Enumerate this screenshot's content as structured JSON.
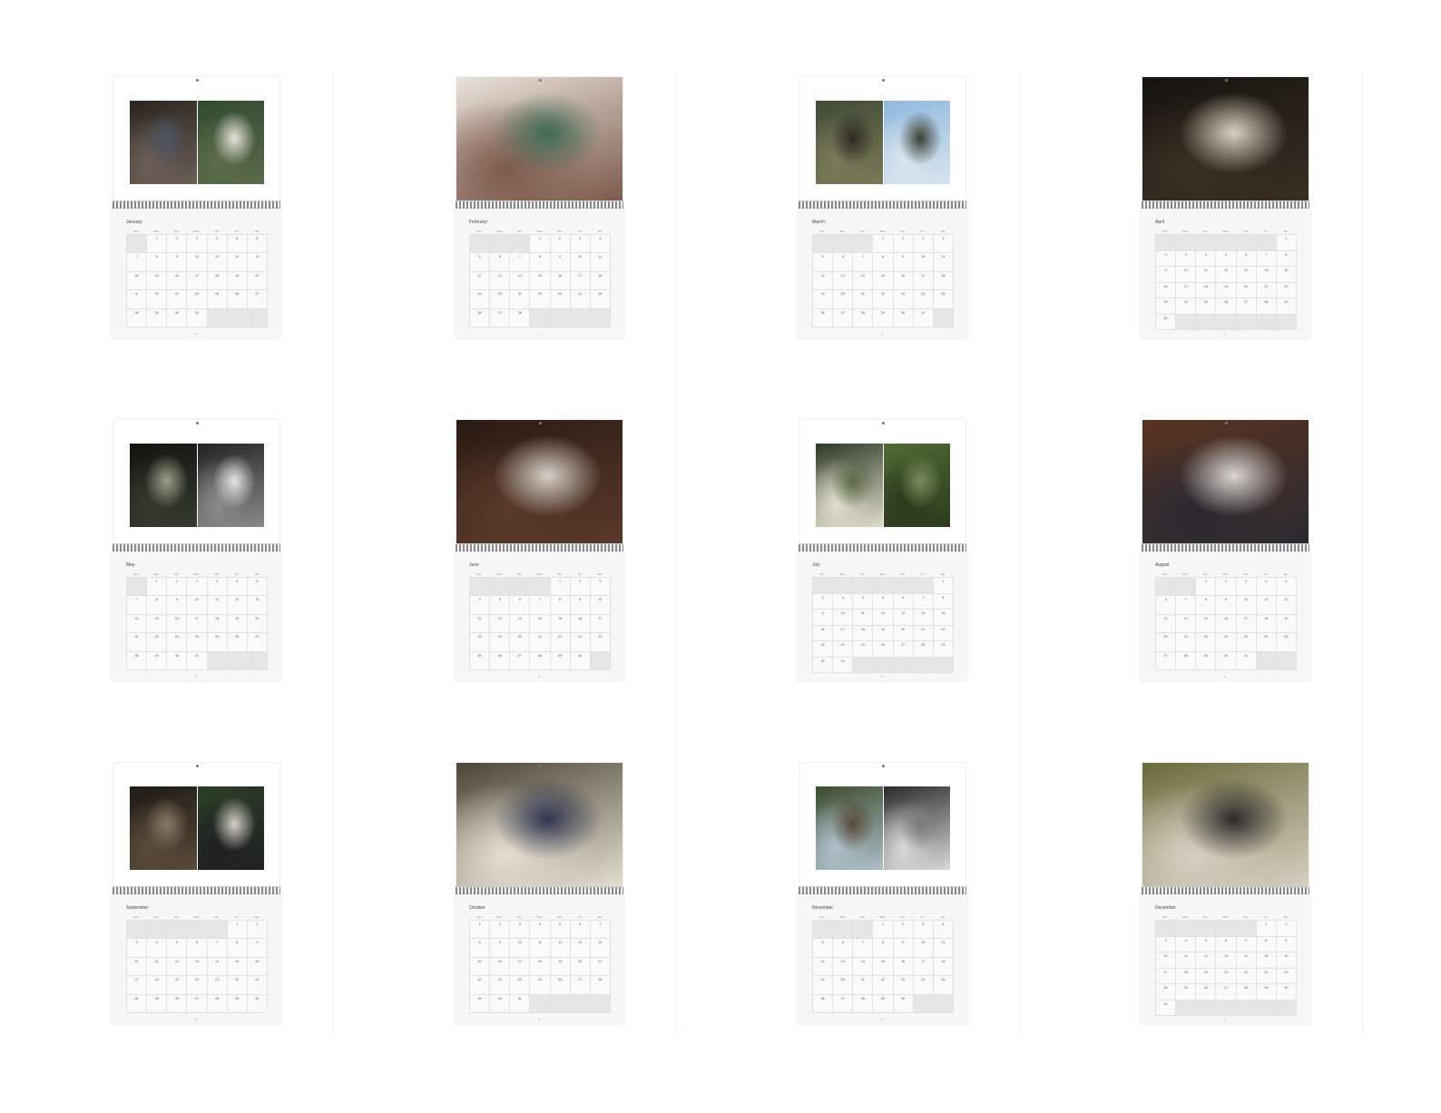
{
  "weekday_headers": [
    "Sun",
    "Mon",
    "Tue",
    "Wed",
    "Thu",
    "Fri",
    "Sat"
  ],
  "calendars": [
    {
      "month": "January",
      "blank_before": 1,
      "days_in_month": 31,
      "photo_layout": "split",
      "photos": [
        {
          "name": "man-reclining-on-sofa-photo",
          "colors": [
            "#2b241f",
            "#6b5f57",
            "#4d5566"
          ]
        },
        {
          "name": "three-men-portrait-photo",
          "colors": [
            "#304a2e",
            "#5b6b4b",
            "#e6e2da"
          ]
        }
      ]
    },
    {
      "month": "February",
      "blank_before": 3,
      "days_in_month": 28,
      "photo_layout": "full",
      "photos": [
        {
          "name": "three-men-at-window-photo",
          "colors": [
            "#e9e2da",
            "#7d5a4c",
            "#3f6b55"
          ]
        }
      ]
    },
    {
      "month": "March",
      "blank_before": 3,
      "days_in_month": 31,
      "photo_layout": "split",
      "photos": [
        {
          "name": "man-in-foliage-photo",
          "colors": [
            "#3f4a33",
            "#7b7a5a",
            "#2e2a24"
          ]
        },
        {
          "name": "three-men-against-sky-photo",
          "colors": [
            "#8fb8de",
            "#d8e4ee",
            "#3b3f33"
          ]
        }
      ]
    },
    {
      "month": "April",
      "blank_before": 6,
      "days_in_month": 30,
      "photo_layout": "full",
      "photos": [
        {
          "name": "man-seated-in-dark-room-photo",
          "colors": [
            "#15130f",
            "#3a2f24",
            "#d8d1bf"
          ]
        }
      ]
    },
    {
      "month": "May",
      "blank_before": 1,
      "days_in_month": 31,
      "photo_layout": "split",
      "photos": [
        {
          "name": "man-in-leather-jacket-photo",
          "colors": [
            "#12140f",
            "#343a2e",
            "#9aa08c"
          ]
        },
        {
          "name": "black-and-white-portrait-photo",
          "colors": [
            "#222222",
            "#8a8a8a",
            "#e5e5e5"
          ]
        }
      ]
    },
    {
      "month": "June",
      "blank_before": 4,
      "days_in_month": 30,
      "photo_layout": "full",
      "photos": [
        {
          "name": "man-sitting-on-bed-photo",
          "colors": [
            "#2a1a14",
            "#5a3a2a",
            "#d6d0c8"
          ]
        }
      ]
    },
    {
      "month": "July",
      "blank_before": 6,
      "days_in_month": 31,
      "photo_layout": "split",
      "photos": [
        {
          "name": "man-in-white-sweater-photo",
          "colors": [
            "#2e3a26",
            "#e0dccd",
            "#5b6a45"
          ]
        },
        {
          "name": "man-lying-in-grass-photo",
          "colors": [
            "#4f6a32",
            "#2b3a1d",
            "#7a8a5a"
          ]
        }
      ]
    },
    {
      "month": "August",
      "blank_before": 2,
      "days_in_month": 31,
      "photo_layout": "full",
      "photos": [
        {
          "name": "man-in-striped-shirt-photo",
          "colors": [
            "#5a3322",
            "#2a2a30",
            "#d9d6d2"
          ]
        }
      ]
    },
    {
      "month": "September",
      "blank_before": 5,
      "days_in_month": 30,
      "photo_layout": "split",
      "photos": [
        {
          "name": "man-reclining-on-steps-photo",
          "colors": [
            "#1e1a16",
            "#5a4a3a",
            "#8a7a66"
          ]
        },
        {
          "name": "three-men-close-portrait-photo",
          "colors": [
            "#2c3f28",
            "#1f2021",
            "#d5cfc6"
          ]
        }
      ]
    },
    {
      "month": "October",
      "blank_before": 0,
      "days_in_month": 31,
      "photo_layout": "full",
      "photos": [
        {
          "name": "three-men-in-bedroom-photo",
          "colors": [
            "#4a4536",
            "#e5dfd2",
            "#2f3550"
          ]
        }
      ]
    },
    {
      "month": "November",
      "blank_before": 3,
      "days_in_month": 30,
      "photo_layout": "split",
      "photos": [
        {
          "name": "man-standing-by-house-photo",
          "colors": [
            "#3d4d2e",
            "#aebfca",
            "#5a4a3a"
          ]
        },
        {
          "name": "man-in-striped-sweater-photo",
          "colors": [
            "#2a2a2a",
            "#d8d8d8",
            "#7a7a7a"
          ]
        }
      ]
    },
    {
      "month": "December",
      "blank_before": 5,
      "days_in_month": 31,
      "photo_layout": "full",
      "photos": [
        {
          "name": "two-men-lying-on-blanket-photo",
          "colors": [
            "#6b6a3a",
            "#d7cfc2",
            "#2a2a2a"
          ]
        }
      ]
    }
  ]
}
